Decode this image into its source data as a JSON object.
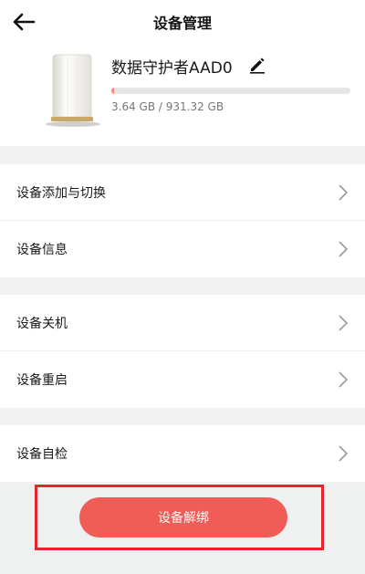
{
  "header": {
    "title": "设备管理",
    "back_icon": "arrow-left-icon"
  },
  "device": {
    "name": "数据守护者AAD0",
    "edit_icon": "pencil-icon",
    "storage_used": "3.64 GB",
    "storage_total": "931.32 GB",
    "storage_text": "3.64 GB / 931.32 GB",
    "usage_fraction": 0.0039
  },
  "menu": {
    "group1": [
      {
        "label": "设备添加与切换"
      },
      {
        "label": "设备信息"
      }
    ],
    "group2": [
      {
        "label": "设备关机"
      },
      {
        "label": "设备重启"
      }
    ],
    "group3": [
      {
        "label": "设备自检"
      }
    ]
  },
  "unbind": {
    "label": "设备解绑"
  },
  "colors": {
    "accent": "#f05c56",
    "highlight": "#e4252e",
    "background": "#f2f2f2"
  }
}
